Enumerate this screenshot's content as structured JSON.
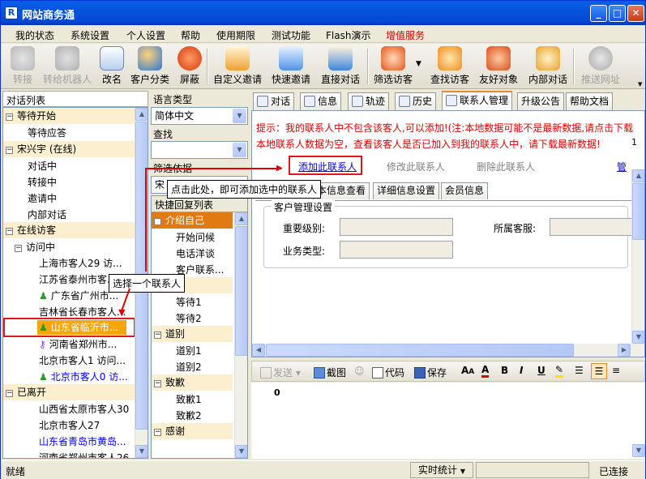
{
  "window": {
    "title": "网站商务通"
  },
  "menu": [
    "我的状态",
    "系统设置",
    "个人设置",
    "帮助",
    "使用期限",
    "测试功能",
    "Flash演示",
    "增值服务"
  ],
  "menu_accent": "#d40000",
  "toolbar": [
    {
      "label": "转接",
      "icon": "transfer-icon",
      "enabled": false
    },
    {
      "label": "转给机器人",
      "icon": "robot-icon",
      "enabled": false
    },
    {
      "label": "改名",
      "icon": "rename-icon",
      "enabled": true
    },
    {
      "label": "客户分类",
      "icon": "customer-group-icon",
      "enabled": true
    },
    {
      "label": "屏蔽",
      "icon": "block-icon",
      "enabled": true
    },
    {
      "label": "自定义邀请",
      "icon": "custom-invite-icon",
      "enabled": true
    },
    {
      "label": "快速邀请",
      "icon": "quick-invite-icon",
      "enabled": true
    },
    {
      "label": "直接对话",
      "icon": "direct-chat-icon",
      "enabled": true
    },
    {
      "label": "筛选访客",
      "icon": "filter-visitor-icon",
      "enabled": true
    },
    {
      "label": "查找访客",
      "icon": "find-visitor-icon",
      "enabled": true
    },
    {
      "label": "友好对象",
      "icon": "friend-icon",
      "enabled": true
    },
    {
      "label": "内部对话",
      "icon": "internal-chat-icon",
      "enabled": true
    },
    {
      "label": "推送网址",
      "icon": "push-url-icon",
      "enabled": false
    }
  ],
  "left": {
    "header": "对话列表",
    "groups": [
      {
        "label": "等待开始",
        "items": [
          "等待应答"
        ]
      },
      {
        "label": "宋兴宇 (在线)",
        "items": [
          "对话中",
          "转接中",
          "邀请中",
          "内部对话"
        ]
      },
      {
        "label": "在线访客",
        "sub": "访问中",
        "visitors": [
          {
            "name": "上海市客人29  访...",
            "color": "#000000"
          },
          {
            "name": "江苏省泰州市客...",
            "color": "#000000"
          },
          {
            "name": "广东省广州市...",
            "color": "#000000"
          },
          {
            "name": "吉林省长春市客人...",
            "color": "#000000"
          },
          {
            "name": "山东省临沂市...",
            "color": "#ffffff",
            "selected": true
          },
          {
            "name": "河南省郑州市...",
            "color": "#000000"
          },
          {
            "name": "北京市客人1  访问...",
            "color": "#000000"
          },
          {
            "name": "北京市客人0  访...",
            "color": "#0000ff"
          }
        ]
      },
      {
        "label": "已离开",
        "visitors": [
          "山西省太原市客人30",
          "北京市客人27",
          "山东省青岛市黄岛...",
          "河南省郑州市客人26"
        ]
      }
    ]
  },
  "middle": {
    "lang_label": "语言类型",
    "lang_value": "简体中文",
    "search_label": "查找",
    "filter_label": "筛选依据",
    "filter_value": "宋",
    "quick_header": "快捷回复列表",
    "quick_groups": [
      {
        "label": "介绍自己",
        "items": [
          "开始问候",
          "电话洋谈",
          "客户联系..."
        ],
        "selected": true
      },
      {
        "label": "",
        "items": [
          "等待1",
          "等待2"
        ]
      },
      {
        "label": "道别",
        "items": [
          "道别1",
          "道别2"
        ]
      },
      {
        "label": "致歉",
        "items": [
          "致歉1",
          "致歉2"
        ]
      },
      {
        "label": "感谢",
        "items": []
      }
    ]
  },
  "tabs": [
    "对话",
    "信息",
    "轨迹",
    "历史",
    "联系人管理",
    "升级公告",
    "帮助文档"
  ],
  "selected_tab": "联系人管理",
  "notice": {
    "line1": "提示：我的联系人中不包含该客人,可以添加!(注:本地数据可能不是最新数据,请点击下载",
    "line2": "本地联系人数据为空，查看该客人是否已加入到我的联系人中，请下载最新数据!",
    "color": "#e00000"
  },
  "contact_actions": [
    "添加此联系人",
    "修改此联系人",
    "删除此联系人",
    "管"
  ],
  "sub_tabs": [
    "本信息查看",
    "详细信息设置",
    "会员信息"
  ],
  "customer_mgmt": {
    "legend": "客户管理设置",
    "importance": "重要级别:",
    "owner": "所属客服:",
    "biz_type": "业务类型:"
  },
  "editor_toolbar": [
    "发送",
    "截图",
    "代码",
    "保存"
  ],
  "editor_content": "0",
  "callouts": {
    "add": "点击此处，即可添加选中的联系人",
    "select": "选择一个联系人"
  },
  "callout_color": "#e00000",
  "status": {
    "left": "就绪",
    "center": "实时统计",
    "right": "已连接"
  }
}
